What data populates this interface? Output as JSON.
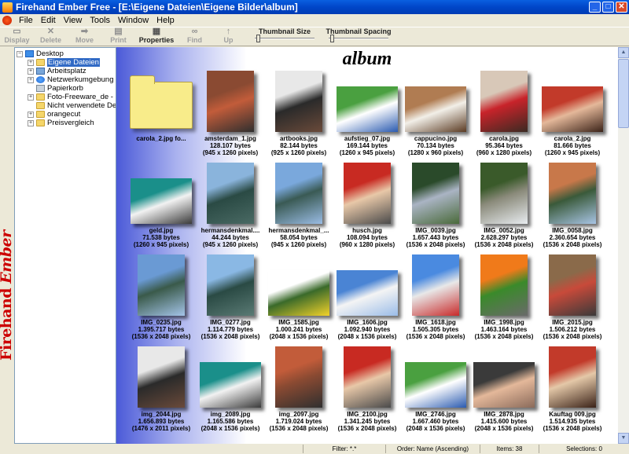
{
  "window": {
    "title": "Firehand Ember Free - [E:\\Eigene Dateien\\Eigene Bilder\\album]",
    "min": "_",
    "max": "□",
    "close": "✕"
  },
  "menu": [
    "File",
    "Edit",
    "View",
    "Tools",
    "Window",
    "Help"
  ],
  "toolbar": {
    "buttons": [
      {
        "label": "Display",
        "icon": "monitor-icon",
        "glyph": "▭",
        "enabled": false
      },
      {
        "label": "Delete",
        "icon": "delete-x-icon",
        "glyph": "✕",
        "enabled": false
      },
      {
        "label": "Move",
        "icon": "move-arrow-icon",
        "glyph": "➡",
        "enabled": false
      },
      {
        "label": "Print",
        "icon": "printer-icon",
        "glyph": "▤",
        "enabled": false
      },
      {
        "label": "Properties",
        "icon": "properties-icon",
        "glyph": "▦",
        "enabled": true
      },
      {
        "label": "Find",
        "icon": "binoculars-icon",
        "glyph": "∞",
        "enabled": false
      },
      {
        "label": "Up",
        "icon": "up-folder-icon",
        "glyph": "↑",
        "enabled": false
      }
    ],
    "thumbnail_size_label": "Thumbnail Size",
    "thumbnail_spacing_label": "Thumbnail Spacing"
  },
  "brand": {
    "part1": "Firehand",
    "part2": "Ember"
  },
  "tree": [
    {
      "label": "Desktop",
      "expander": "−",
      "icon": "desktop-icon",
      "level": 0
    },
    {
      "label": "Eigene Dateien",
      "expander": "+",
      "icon": "folder-icon",
      "level": 1,
      "selected": true
    },
    {
      "label": "Arbeitsplatz",
      "expander": "+",
      "icon": "computer-icon",
      "level": 1
    },
    {
      "label": "Netzwerkumgebung",
      "expander": "+",
      "icon": "network-icon",
      "level": 1
    },
    {
      "label": "Papierkorb",
      "expander": "",
      "icon": "recycle-bin-icon",
      "level": 1
    },
    {
      "label": "Foto-Freeware_de - Koste",
      "expander": "+",
      "icon": "folder-icon",
      "level": 1
    },
    {
      "label": "Nicht verwendete Desktop",
      "expander": "",
      "icon": "folder-icon",
      "level": 1
    },
    {
      "label": "orangecut",
      "expander": "+",
      "icon": "folder-icon",
      "level": 1
    },
    {
      "label": "Preisvergleich",
      "expander": "+",
      "icon": "folder-icon",
      "level": 1
    }
  ],
  "album_title": "album",
  "items": [
    {
      "name": "carola_2.jpg fo...",
      "size": "",
      "dims": "",
      "folder": true
    },
    {
      "name": "amsterdam_1.jpg",
      "size": "128.107 bytes",
      "dims": "(945 x 1260 pixels)",
      "orient": "p",
      "colors": [
        "#8a4a32",
        "#c25c3a",
        "#2f2f2f"
      ]
    },
    {
      "name": "artbooks.jpg",
      "size": "82.144 bytes",
      "dims": "(925 x 1260 pixels)",
      "orient": "p",
      "colors": [
        "#e8e8e8",
        "#2a2a2a",
        "#6a4a3a"
      ]
    },
    {
      "name": "aufstieg_07.jpg",
      "size": "169.144 bytes",
      "dims": "(1260 x 945 pixels)",
      "orient": "l",
      "colors": [
        "#4aa040",
        "#ffffff",
        "#2a5ab0"
      ]
    },
    {
      "name": "cappucino.jpg",
      "size": "70.134 bytes",
      "dims": "(1280 x 960 pixels)",
      "orient": "l",
      "colors": [
        "#b07c52",
        "#f2efe8",
        "#5a3a22"
      ]
    },
    {
      "name": "carola.jpg",
      "size": "95.364 bytes",
      "dims": "(960 x 1280 pixels)",
      "orient": "p",
      "colors": [
        "#d8c8b8",
        "#c8232a",
        "#3a2a22"
      ]
    },
    {
      "name": "carola_2.jpg",
      "size": "81.666 bytes",
      "dims": "(1260 x 945 pixels)",
      "orient": "l",
      "colors": [
        "#c23a2a",
        "#e4b89a",
        "#3a2218"
      ]
    },
    {
      "name": "geld.jpg",
      "size": "71.538 bytes",
      "dims": "(1260 x 945 pixels)",
      "orient": "l",
      "colors": [
        "#1a8f8a",
        "#f2f2f2",
        "#3a3a3a"
      ]
    },
    {
      "name": "hermansdenkmal....",
      "size": "44.244 bytes",
      "dims": "(945 x 1260 pixels)",
      "orient": "p",
      "colors": [
        "#8ab4dc",
        "#2a4a44",
        "#4a6a64"
      ]
    },
    {
      "name": "hermansdenkmal_...",
      "size": "58.054 bytes",
      "dims": "(945 x 1260 pixels)",
      "orient": "p",
      "colors": [
        "#7aa8dc",
        "#3a5a54",
        "#9abce4"
      ]
    },
    {
      "name": "husch.jpg",
      "size": "108.094 bytes",
      "dims": "(960 x 1280 pixels)",
      "orient": "p",
      "colors": [
        "#c82a22",
        "#e8c8a8",
        "#4a4a4a"
      ]
    },
    {
      "name": "IMG_0039.jpg",
      "size": "1.657.443 bytes",
      "dims": "(1536 x 2048 pixels)",
      "orient": "p",
      "colors": [
        "#2a4a2a",
        "#aab4c4",
        "#4a6a3a"
      ]
    },
    {
      "name": "IMG_0052.jpg",
      "size": "2.628.297 bytes",
      "dims": "(1536 x 2048 pixels)",
      "orient": "p",
      "colors": [
        "#3a5a2a",
        "#8a8a7a",
        "#e8ecf0"
      ]
    },
    {
      "name": "IMG_0058.jpg",
      "size": "2.360.654 bytes",
      "dims": "(1536 x 2048 pixels)",
      "orient": "p",
      "colors": [
        "#c8784a",
        "#3a5a3a",
        "#a8c4e4"
      ]
    },
    {
      "name": "IMG_0235.jpg",
      "size": "1.395.717 bytes",
      "dims": "(1536 x 2048 pixels)",
      "orient": "p",
      "colors": [
        "#6a9ad4",
        "#3a5a4a",
        "#a4c4e8"
      ]
    },
    {
      "name": "IMG_0277.jpg",
      "size": "1.114.779 bytes",
      "dims": "(1536 x 2048 pixels)",
      "orient": "p",
      "colors": [
        "#8ab8e4",
        "#2a4a44",
        "#5a7a74"
      ]
    },
    {
      "name": "IMG_1585.jpg",
      "size": "1.000.241 bytes",
      "dims": "(2048 x 1536 pixels)",
      "orient": "l",
      "colors": [
        "#ffffff",
        "#3a6a2a",
        "#f2d22a"
      ]
    },
    {
      "name": "IMG_1606.jpg",
      "size": "1.092.940 bytes",
      "dims": "(2048 x 1536 pixels)",
      "orient": "l",
      "colors": [
        "#4a84d4",
        "#f4f4f4",
        "#9abce8"
      ]
    },
    {
      "name": "IMG_1618.jpg",
      "size": "1.505.305 bytes",
      "dims": "(1536 x 2048 pixels)",
      "orient": "p",
      "colors": [
        "#4a8ae0",
        "#e8e8e8",
        "#c82a2a"
      ]
    },
    {
      "name": "IMG_1998.jpg",
      "size": "1.463.164 bytes",
      "dims": "(1536 x 2048 pixels)",
      "orient": "p",
      "colors": [
        "#f07a1a",
        "#3a8a2a",
        "#6a6a6a"
      ]
    },
    {
      "name": "IMG_2015.jpg",
      "size": "1.506.212 bytes",
      "dims": "(1536 x 2048 pixels)",
      "orient": "p",
      "colors": [
        "#8a6a4a",
        "#c84a3a",
        "#3a3a3a"
      ]
    },
    {
      "name": "img_2044.jpg",
      "size": "1.656.893 bytes",
      "dims": "(1476 x 2011 pixels)",
      "orient": "p",
      "colors": [
        "#e8e8e8",
        "#2a2a2a",
        "#6a4a3a"
      ]
    },
    {
      "name": "img_2089.jpg",
      "size": "1.165.586 bytes",
      "dims": "(2048 x 1536 pixels)",
      "orient": "l",
      "colors": [
        "#1a8f8a",
        "#f2f2f2",
        "#3a3a3a"
      ]
    },
    {
      "name": "img_2097.jpg",
      "size": "1.719.024 bytes",
      "dims": "(1536 x 2048 pixels)",
      "orient": "p",
      "colors": [
        "#c25c3a",
        "#8a4a32",
        "#2f2f2f"
      ]
    },
    {
      "name": "IMG_2100.jpg",
      "size": "1.341.245 bytes",
      "dims": "(1536 x 2048 pixels)",
      "orient": "p",
      "colors": [
        "#c82a22",
        "#e8c8a8",
        "#4a4a4a"
      ]
    },
    {
      "name": "IMG_2746.jpg",
      "size": "1.667.460 bytes",
      "dims": "(2048 x 1536 pixels)",
      "orient": "l",
      "colors": [
        "#4aa040",
        "#ffffff",
        "#2a5ab0"
      ]
    },
    {
      "name": "IMG_2878.jpg",
      "size": "1.415.600 bytes",
      "dims": "(2048 x 1536 pixels)",
      "orient": "l",
      "colors": [
        "#3a3a3a",
        "#e4b89a",
        "#8a6a5a"
      ]
    },
    {
      "name": "Kauftag 009.jpg",
      "size": "1.514.935 bytes",
      "dims": "(1536 x 2048 pixels)",
      "orient": "p",
      "colors": [
        "#c23a2a",
        "#e4c8a8",
        "#3a2218"
      ]
    }
  ],
  "status": {
    "filter": "Filter: *.*",
    "order": "Order: Name (Ascending)",
    "items": "Items: 38",
    "selections": "Selections: 0"
  },
  "scroll": {
    "up": "▲",
    "down": "▼"
  }
}
